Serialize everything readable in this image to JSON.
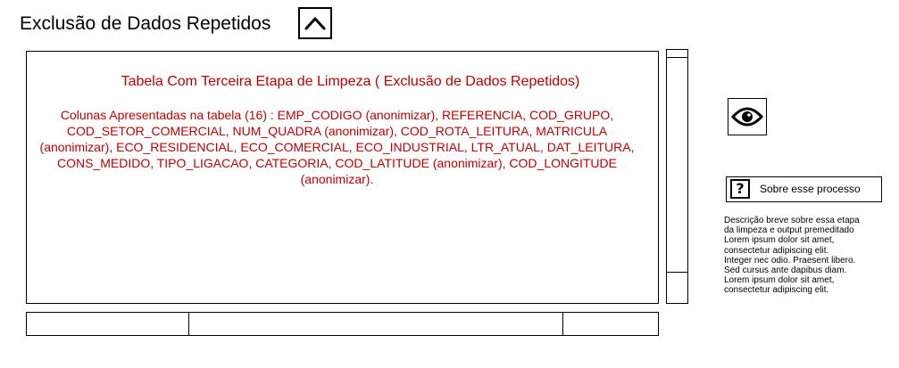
{
  "header": {
    "title": "Exclusão de Dados Repetidos",
    "collapse_icon": "chevron-up-icon"
  },
  "panel": {
    "heading": "Tabela Com Terceira Etapa de Limpeza ( Exclusão de Dados Repetidos)",
    "columns_text": "Colunas Apresentadas na tabela (16) : EMP_CODIGO (anonimizar), REFERENCIA, COD_GRUPO, COD_SETOR_COMERCIAL, NUM_QUADRA (anonimizar), COD_ROTA_LEITURA, MATRICULA (anonimizar), ECO_RESIDENCIAL, ECO_COMERCIAL, ECO_INDUSTRIAL, LTR_ATUAL, DAT_LEITURA, CONS_MEDIDO, TIPO_LIGACAO, CATEGORIA, COD_LATITUDE (anonimizar), COD_LONGITUDE (anonimizar).",
    "text_color": "#c00000"
  },
  "sidebar": {
    "view_icon": "eye-icon",
    "help_icon": "question-icon",
    "help_glyph": "?",
    "help_label": "Sobre esse processo",
    "description_lines": [
      "Descrição breve sobre essa etapa",
      "da limpeza e output premeditado",
      "Lorem ipsum dolor sit amet,",
      "consectetur adipiscing elit.",
      "Integer nec odio. Praesent libero.",
      "Sed cursus ante dapibus diam.",
      "Lorem ipsum dolor sit amet,",
      "consectetur adipiscing elit."
    ]
  }
}
